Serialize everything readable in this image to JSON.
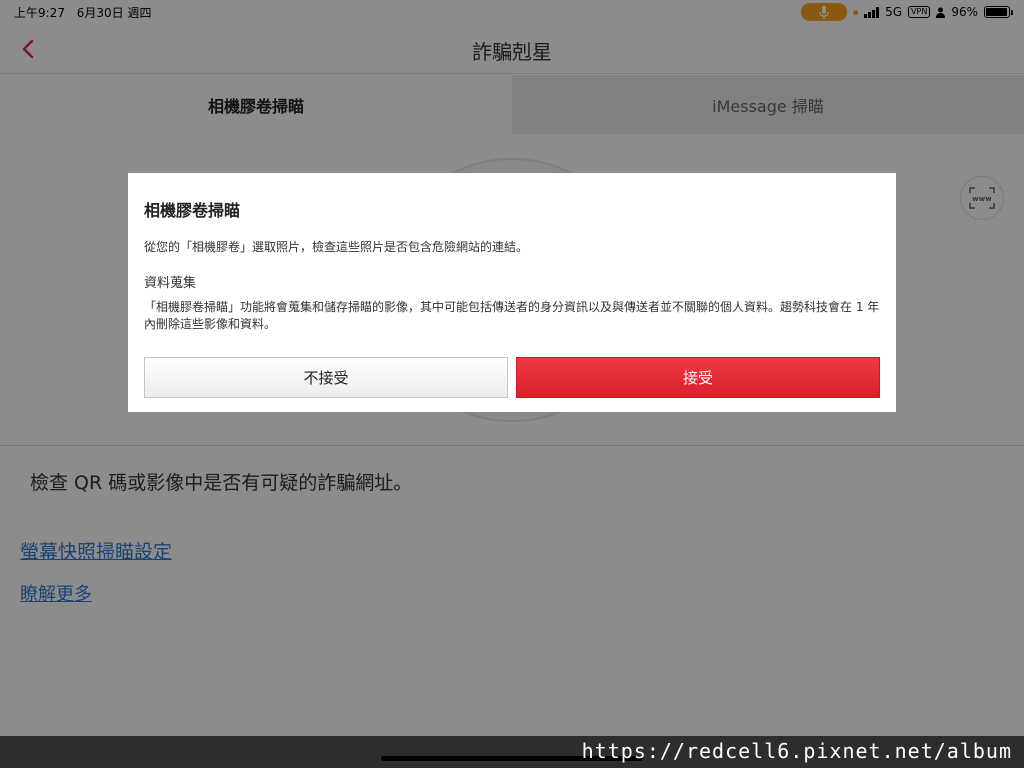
{
  "status_bar": {
    "time": "上午9:27",
    "date": "6月30日 週四",
    "network": "5G",
    "vpn": "VPN",
    "battery": "96%",
    "battery_level": 0.96
  },
  "nav": {
    "title": "詐騙剋星"
  },
  "tabs": [
    {
      "label": "相機膠卷掃瞄",
      "active": true
    },
    {
      "label": "iMessage 掃瞄",
      "active": false
    }
  ],
  "main": {
    "description": "檢查 QR 碼或影像中是否有可疑的詐騙網址。",
    "link_settings": "螢幕快照掃瞄設定",
    "link_learn_more": "瞭解更多"
  },
  "dialog": {
    "title": "相機膠卷掃瞄",
    "body": "從您的「相機膠卷」選取照片，檢查這些照片是否包含危險網站的連結。",
    "subheading": "資料蒐集",
    "body2": "「相機膠卷掃瞄」功能將會蒐集和儲存掃瞄的影像，其中可能包括傳送者的身分資訊以及與傳送者並不關聯的個人資料。趨勢科技會在 1 年內刪除這些影像和資料。",
    "decline_label": "不接受",
    "accept_label": "接受"
  },
  "watermark": "https://redcell6.pixnet.net/album",
  "colors": {
    "accent_red": "#e02a35",
    "link_blue": "#2f7bd8",
    "mic_orange": "#f7a21b"
  }
}
